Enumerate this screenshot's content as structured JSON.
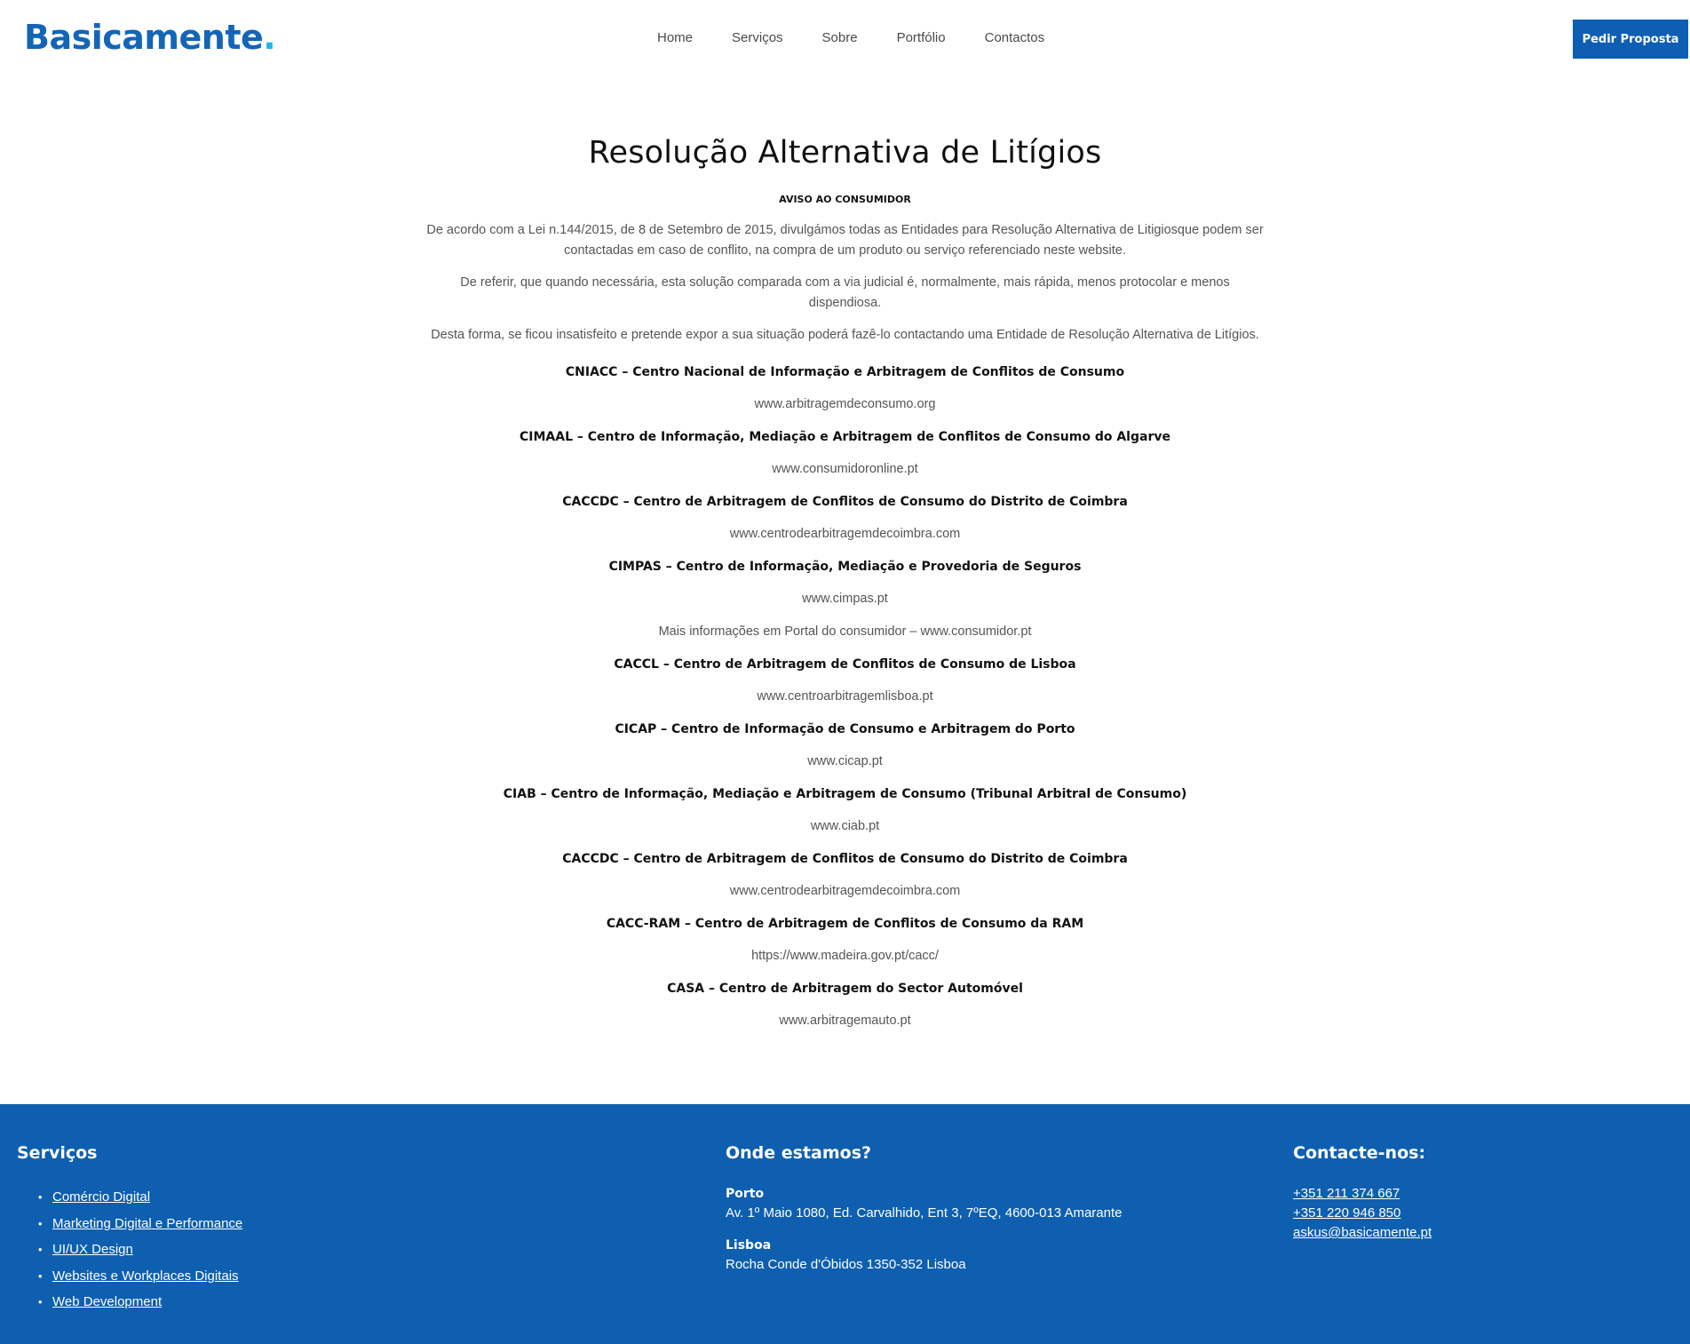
{
  "header": {
    "logo_text": "Basicamente",
    "logo_dot": ".",
    "nav": [
      "Home",
      "Serviços",
      "Sobre",
      "Portfólio",
      "Contactos"
    ],
    "cta_label": "Pedir Proposta"
  },
  "main": {
    "title": "Resolução Alternativa de Litígios",
    "notice": "AVISO AO CONSUMIDOR",
    "paragraphs": [
      "De acordo com a Lei n.144/2015, de 8 de Setembro de 2015, divulgámos todas as Entidades para Resolução Alternativa de Litigiosque podem ser contactadas em caso de conflito, na compra de um produto ou serviço referenciado neste website.",
      "De referir, que quando necessária, esta solução comparada com a via judicial é, normalmente, mais rápida, menos protocolar e menos dispendiosa.",
      "Desta forma, se ficou insatisfeito e pretende expor a sua situação poderá fazê-lo contactando uma Entidade de Resolução Alternativa de Litígios."
    ],
    "entities": [
      {
        "name": "CNIACC – Centro Nacional de Informação e Arbitragem de Conflitos de Consumo",
        "url": "www.arbitragemdeconsumo.org"
      },
      {
        "name": "CIMAAL – Centro de Informação, Mediação e Arbitragem de Conflitos de Consumo do Algarve",
        "url": "www.consumidoronline.pt"
      },
      {
        "name": "CACCDC – Centro de Arbitragem de Conflitos de Consumo do Distrito de Coimbra",
        "url": "www.centrodearbitragemdecoimbra.com"
      },
      {
        "name": "CIMPAS – Centro de Informação, Mediação e Provedoria de Seguros",
        "url": "www.cimpas.pt",
        "extra": "Mais informações em Portal do consumidor – www.consumidor.pt"
      },
      {
        "name": "CACCL – Centro de Arbitragem de Conflitos de Consumo de Lisboa",
        "url": "www.centroarbitragemlisboa.pt"
      },
      {
        "name": "CICAP – Centro de Informação de Consumo e Arbitragem do Porto",
        "url": "www.cicap.pt"
      },
      {
        "name": "CIAB – Centro de Informação, Mediação e Arbitragem de Consumo (Tribunal Arbitral de Consumo)",
        "url": "www.ciab.pt"
      },
      {
        "name": "CACCDC – Centro de Arbitragem de Conflitos de Consumo do Distrito de Coimbra",
        "url": "www.centrodearbitragemdecoimbra.com"
      },
      {
        "name": "CACC-RAM – Centro de Arbitragem de Conflitos de Consumo da RAM",
        "url": "https://www.madeira.gov.pt/cacc/"
      },
      {
        "name": "CASA – Centro de Arbitragem do Sector Automóvel",
        "url": "www.arbitragemauto.pt"
      }
    ]
  },
  "footer": {
    "services": {
      "heading": "Serviços",
      "items": [
        "Comércio Digital",
        "Marketing Digital e Performance",
        "UI/UX Design",
        "Websites e Workplaces Digitais",
        "Web Development"
      ]
    },
    "location": {
      "heading": "Onde estamos?",
      "porto_label": "Porto",
      "porto_address": "Av. 1º Maio 1080, Ed. Carvalhido, Ent 3, 7ºEQ, 4600-013 Amarante",
      "lisboa_label": "Lisboa",
      "lisboa_address": "Rocha Conde d'Óbidos 1350-352 Lisboa"
    },
    "contact": {
      "heading": "Contacte-nos:",
      "phone1": "+351 211 374 667",
      "phone2": "+351 220 946 850",
      "email": "askus@basicamente.pt"
    }
  },
  "colors": {
    "brand": "#1565b7",
    "accent": "#1fb6ea",
    "footer_bg": "#0e5fb0",
    "cta_bg": "#0e5fb4"
  }
}
